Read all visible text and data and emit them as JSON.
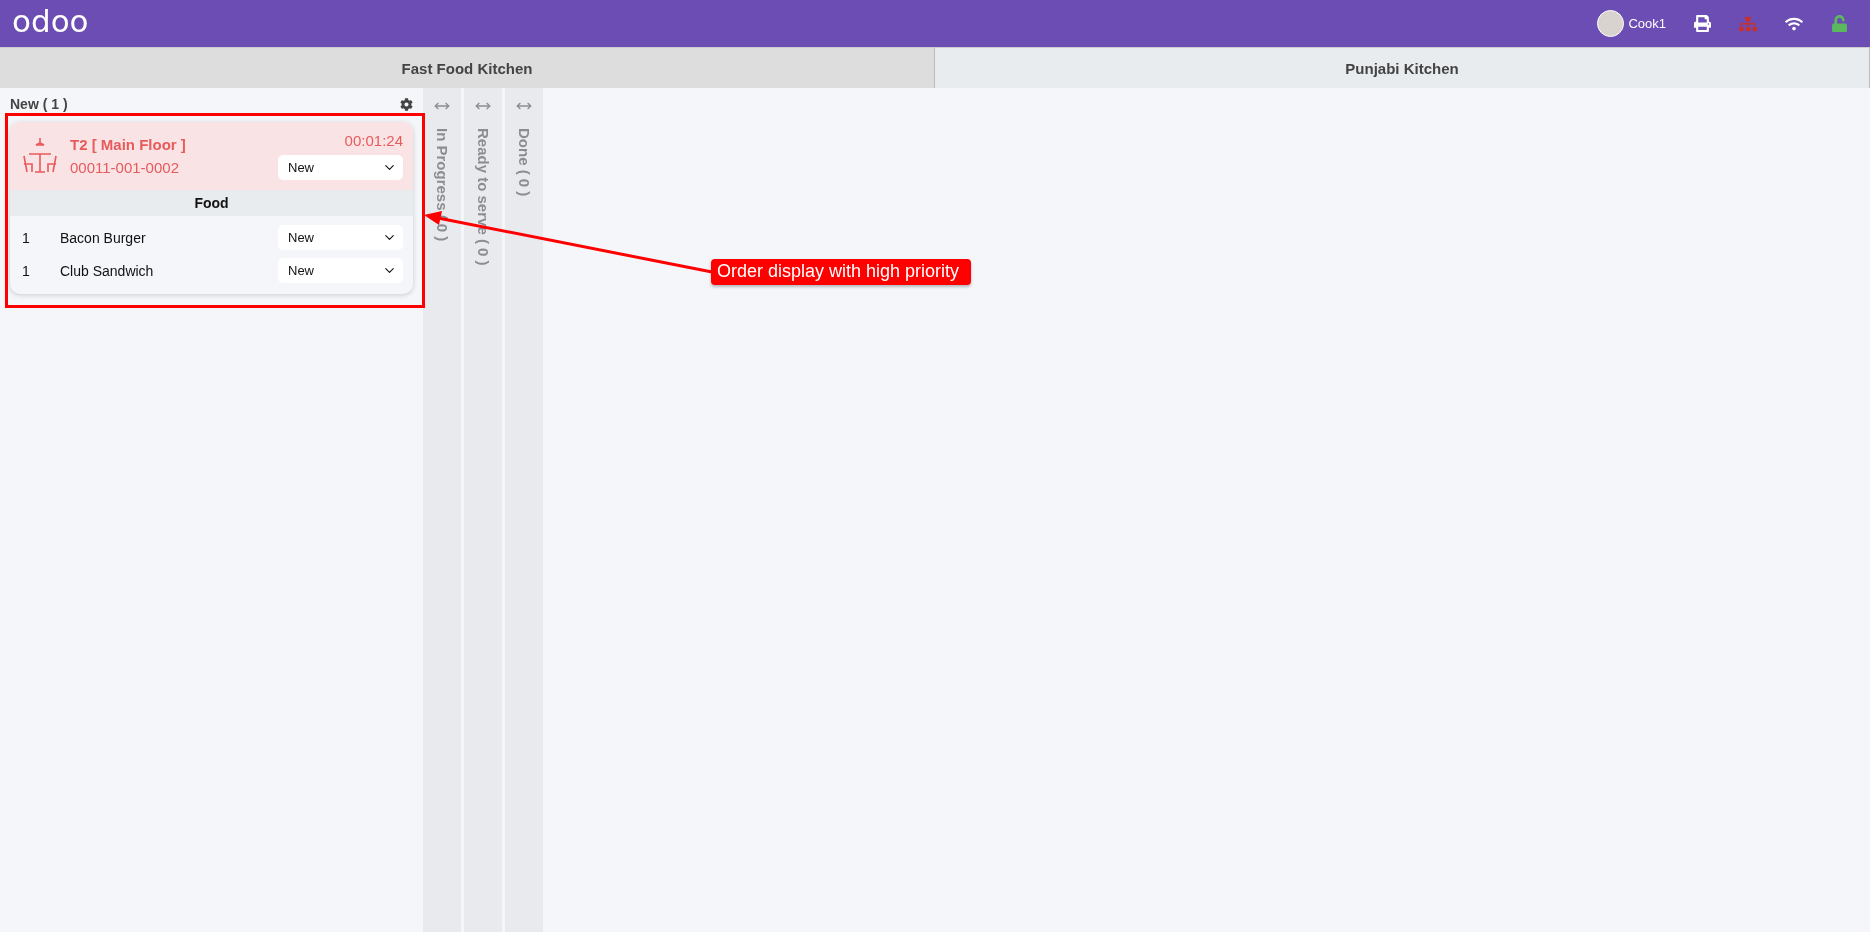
{
  "navbar": {
    "logo": "odoo",
    "user": "Cook1"
  },
  "kitchens": [
    {
      "label": "Fast Food Kitchen",
      "selected": true
    },
    {
      "label": "Punjabi Kitchen",
      "selected": false
    }
  ],
  "stages": [
    {
      "title": "New ( 1 )",
      "expanded": true,
      "orders": [
        {
          "table": "T2 [ Main Floor ]",
          "reference": "00011-001-0002",
          "elapsed": "00:01:24",
          "status": "New",
          "urgent": true,
          "categories": [
            {
              "name": "Food",
              "lines": [
                {
                  "qty": "1",
                  "product": "Bacon Burger",
                  "status": "New"
                },
                {
                  "qty": "1",
                  "product": "Club Sandwich",
                  "status": "New"
                }
              ]
            }
          ]
        }
      ]
    },
    {
      "title": "In Progress ( 0 )",
      "expanded": false
    },
    {
      "title": "Ready to serve ( 0 )",
      "expanded": false
    },
    {
      "title": "Done ( 0 )",
      "expanded": false
    }
  ],
  "annotation": {
    "text": "Order display with high priority"
  }
}
